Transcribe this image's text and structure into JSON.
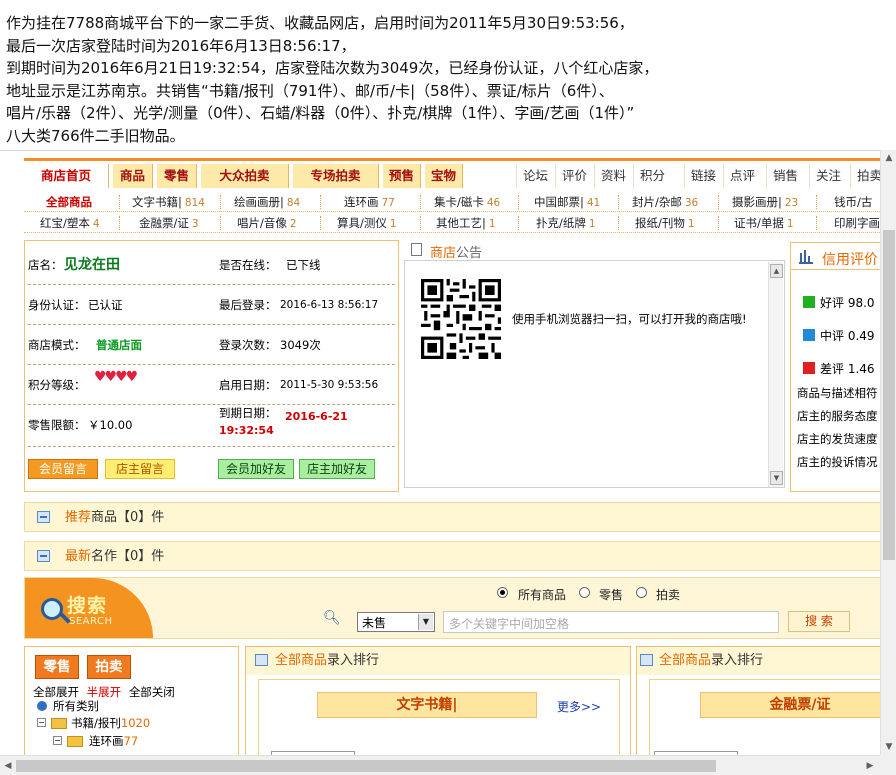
{
  "intro": {
    "lines": [
      "作为挂在7788商城平台下的一家二手货、收藏品网店，启用时间为2011年5月30日9:53:56，",
      "最后一次店家登陆时间为2016年6月13日8:56:17，",
      "到期时间为2016年6月21日19:32:54，店家登陆次数为3049次，已经身份认证，八个红心店家，",
      "地址显示是江苏南京。共销售“书籍/报刊（791件）、邮/币/卡|（58件）、票证/标片（6件）、",
      "唱片/乐器（2件）、光学/测量（0件）、石蜡/料器（0件）、扑克/棋牌（1件）、字画/艺画（1件）”",
      "八大类766件二手旧物品。"
    ]
  },
  "nav": {
    "primary": [
      "商店首页",
      "商品",
      "零售",
      "大众拍卖",
      "专场拍卖",
      "预售",
      "宝物"
    ],
    "secondary": [
      "论坛",
      "评价",
      "资料",
      "积分",
      "链接",
      "点评",
      "销售",
      "关注",
      "拍卖"
    ]
  },
  "categories": {
    "row1": [
      {
        "name": "全部商品",
        "count": ""
      },
      {
        "name": "文字书籍|",
        "count": "814"
      },
      {
        "name": "绘画画册|",
        "count": "84"
      },
      {
        "name": "连环画",
        "count": "77"
      },
      {
        "name": "集卡/磁卡",
        "count": "46"
      },
      {
        "name": "中国邮票|",
        "count": "41"
      },
      {
        "name": "封片/杂邮",
        "count": "36"
      },
      {
        "name": "摄影画册|",
        "count": "23"
      },
      {
        "name": "钱币/古",
        "count": ""
      }
    ],
    "row2": [
      {
        "name": "红宝/塑本",
        "count": "4"
      },
      {
        "name": "金融票/证",
        "count": "3"
      },
      {
        "name": "唱片/音像",
        "count": "2"
      },
      {
        "name": "算具/测仪",
        "count": "1"
      },
      {
        "name": "其他工艺|",
        "count": "1"
      },
      {
        "name": "扑克/纸牌",
        "count": "1"
      },
      {
        "name": "报纸/刊物",
        "count": "1"
      },
      {
        "name": "证书/单据",
        "count": "1"
      },
      {
        "name": "印刷字画",
        "count": ""
      }
    ]
  },
  "shop": {
    "name_label": "店名：",
    "name": "见龙在田",
    "online_label": "是否在线：",
    "online": "已下线",
    "auth_label": "身份认证：",
    "auth": "已认证",
    "last_login_label": "最后登录：",
    "last_login": "2016-6-13 8:56:17",
    "mode_label": "商店模式：",
    "mode": "普通店面",
    "login_count_label": "登录次数：",
    "login_count": "3049次",
    "level_label": "积分等级：",
    "hearts": 4,
    "start_label": "启用日期：",
    "start": "2011-5-30 9:53:56",
    "limit_label": "零售限额：",
    "limit": "￥10.00",
    "expire_label": "到期日期：",
    "expire": "2016-6-21 19:32:54",
    "buttons": [
      "会员留言",
      "店主留言",
      "会员加好友",
      "店主加好友"
    ]
  },
  "notice": {
    "title_a": "商店",
    "title_b": "公告",
    "qr_text": "使用手机浏览器扫一扫，可以打开我的商店哦!"
  },
  "credit": {
    "title": "信用评价",
    "items": [
      {
        "label": "好评",
        "value": "98.0",
        "color": "#1fb01f"
      },
      {
        "label": "中评",
        "value": "0.49",
        "color": "#2288d8"
      },
      {
        "label": "差评",
        "value": "1.46",
        "color": "#e02020"
      }
    ],
    "lines": [
      "商品与描述相符",
      "店主的服务态度",
      "店主的发货速度",
      "店主的投诉情况"
    ]
  },
  "bands": {
    "recommend": {
      "hl": "推荐",
      "rest": "商品【0】件"
    },
    "newest": {
      "hl": "最新",
      "rest": "名作【0】件"
    }
  },
  "search": {
    "logo_big": "搜索",
    "logo_small": "SEARCH",
    "options": [
      "所有商品",
      "零售",
      "拍卖"
    ],
    "status": "未售",
    "placeholder": "多个关键字中间加空格",
    "button": "搜 索"
  },
  "tree": {
    "tabs": [
      "零售",
      "拍卖"
    ],
    "controls": [
      "全部展开",
      "半展开",
      "全部关闭"
    ],
    "items": [
      "所有类别",
      "书籍/报刊",
      "连环画"
    ],
    "counts": [
      "1020",
      "77"
    ]
  },
  "ranks": [
    {
      "hl": "全部商品",
      "rest": "录入排行",
      "cat": "文字书籍|",
      "more": "更多>>"
    },
    {
      "hl": "全部商品",
      "rest": "录入排行",
      "cat": "金融票/证"
    }
  ]
}
